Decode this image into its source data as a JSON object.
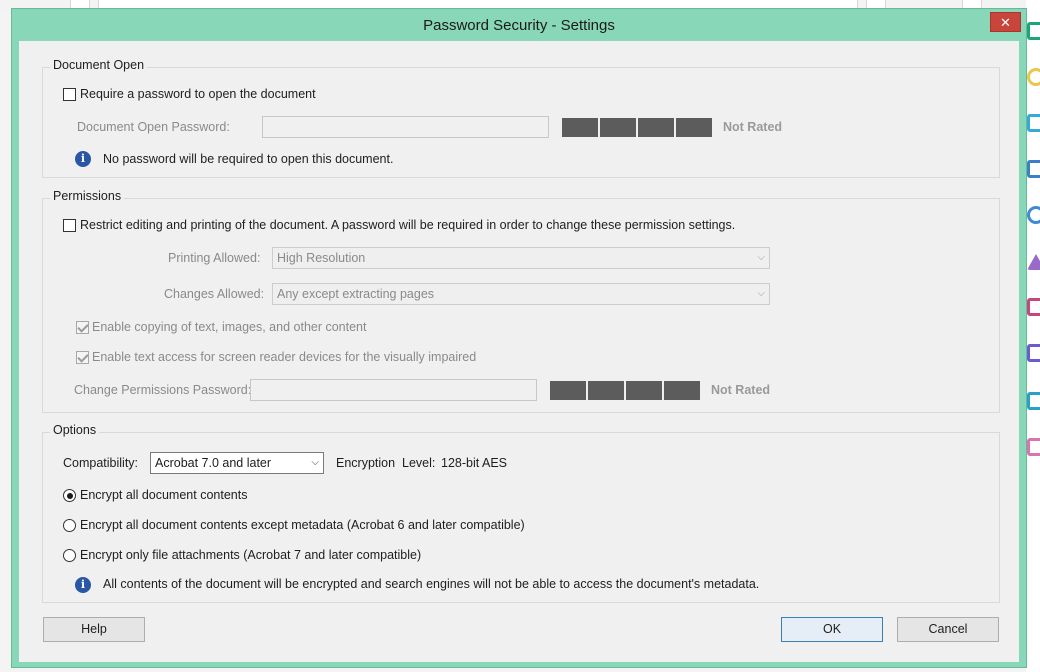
{
  "window": {
    "title": "Password Security - Settings",
    "close_glyph": "✕"
  },
  "document_open": {
    "group_label": "Document Open",
    "require_label": "Require a password to open the document",
    "require_checked": false,
    "password_label": "Document Open Password:",
    "password_value": "",
    "rating": "Not Rated",
    "info_text": "No password will be required to open this document."
  },
  "permissions": {
    "group_label": "Permissions",
    "restrict_label": "Restrict editing and printing of the document. A password will be required in order to change these permission settings.",
    "restrict_checked": false,
    "printing_label": "Printing Allowed:",
    "printing_value": "High Resolution",
    "changes_label": "Changes Allowed:",
    "changes_value": "Any except extracting pages",
    "copy_label": "Enable copying of text, images, and other content",
    "copy_checked": true,
    "screen_reader_label": "Enable text access for screen reader devices for the visually impaired",
    "screen_reader_checked": true,
    "password_label": "Change Permissions Password:",
    "password_value": "",
    "rating": "Not Rated"
  },
  "options": {
    "group_label": "Options",
    "compat_label": "Compatibility:",
    "compat_value": "Acrobat 7.0 and later",
    "enc_level_label": "Encryption  Level:",
    "enc_level_value": "128-bit AES",
    "radio_all": "Encrypt all document contents",
    "radio_except_meta": "Encrypt all document contents except metadata (Acrobat 6 and later compatible)",
    "radio_attachments": "Encrypt only file attachments (Acrobat 7 and later compatible)",
    "selected": "all",
    "info_text": "All contents of the document will be encrypted and search engines will not be able to access the document's metadata."
  },
  "buttons": {
    "help": "Help",
    "ok": "OK",
    "cancel": "Cancel"
  },
  "colors": {
    "titlebar": "#88d7b8",
    "close": "#c7453a",
    "meter": "#5c5c5c",
    "info": "#2a56a6"
  },
  "icons": {
    "info": "info-icon",
    "close": "close-icon",
    "dropdown": "chevron-down-icon"
  }
}
